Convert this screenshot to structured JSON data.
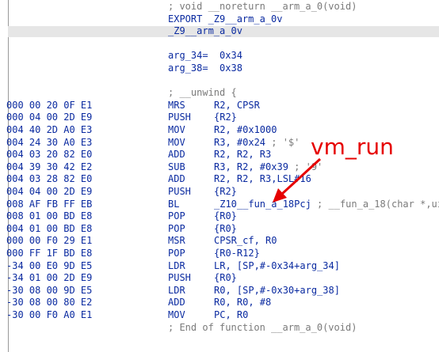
{
  "header_lines": [
    {
      "text": "; void __noreturn __arm_a_0(void)",
      "kind": "comment"
    },
    {
      "text": "EXPORT _Z9__arm_a_0v",
      "kind": "code"
    },
    {
      "text": "_Z9__arm_a_0v",
      "kind": "label"
    },
    {
      "text": "",
      "kind": "blank"
    },
    {
      "text": "arg_34=  0x34",
      "kind": "code"
    },
    {
      "text": "arg_38=  0x38",
      "kind": "code"
    },
    {
      "text": "",
      "kind": "blank"
    },
    {
      "text": "; __unwind {",
      "kind": "comment"
    }
  ],
  "instructions": [
    {
      "bytes": "000 00 20 0F E1",
      "mnemonic": "MRS",
      "operands": "R2, CPSR",
      "comment": ""
    },
    {
      "bytes": "000 04 00 2D E9",
      "mnemonic": "PUSH",
      "operands": "{R2}",
      "comment": ""
    },
    {
      "bytes": "004 40 2D A0 E3",
      "mnemonic": "MOV",
      "operands": "R2, #0x1000",
      "comment": ""
    },
    {
      "bytes": "004 24 30 A0 E3",
      "mnemonic": "MOV",
      "operands": "R3, #0x24",
      "comment": " ; '$'"
    },
    {
      "bytes": "004 03 20 82 E0",
      "mnemonic": "ADD",
      "operands": "R2, R2, R3",
      "comment": ""
    },
    {
      "bytes": "004 39 30 42 E2",
      "mnemonic": "SUB",
      "operands": "R3, R2, #0x39",
      "comment": " ; '9'"
    },
    {
      "bytes": "004 03 28 82 E0",
      "mnemonic": "ADD",
      "operands": "R2, R2, R3,LSL#16",
      "comment": ""
    },
    {
      "bytes": "004 04 00 2D E9",
      "mnemonic": "PUSH",
      "operands": "{R2}",
      "comment": ""
    },
    {
      "bytes": "008 AF FB FF EB",
      "mnemonic": "BL",
      "operands": "_Z10__fun_a_18Pcj",
      "comment": " ; __fun_a_18(char *,ui"
    },
    {
      "bytes": "008 01 00 BD E8",
      "mnemonic": "POP",
      "operands": "{R0}",
      "comment": ""
    },
    {
      "bytes": "004 01 00 BD E8",
      "mnemonic": "POP",
      "operands": "{R0}",
      "comment": ""
    },
    {
      "bytes": "000 00 F0 29 E1",
      "mnemonic": "MSR",
      "operands": "CPSR_cf, R0",
      "comment": ""
    },
    {
      "bytes": "000 FF 1F BD E8",
      "mnemonic": "POP",
      "operands": "{R0-R12}",
      "comment": ""
    },
    {
      "bytes": "-34 00 E0 9D E5",
      "mnemonic": "LDR",
      "operands": "LR, [SP,#-0x34+arg_34]",
      "comment": ""
    },
    {
      "bytes": "-34 01 00 2D E9",
      "mnemonic": "PUSH",
      "operands": "{R0}",
      "comment": ""
    },
    {
      "bytes": "-30 08 00 9D E5",
      "mnemonic": "LDR",
      "operands": "R0, [SP,#-0x30+arg_38]",
      "comment": ""
    },
    {
      "bytes": "-30 08 00 80 E2",
      "mnemonic": "ADD",
      "operands": "R0, R0, #8",
      "comment": ""
    },
    {
      "bytes": "-30 00 F0 A0 E1",
      "mnemonic": "MOV",
      "operands": "PC, R0",
      "comment": ""
    }
  ],
  "footer_line": "; End of function __arm_a_0(void)",
  "annotation": {
    "text": "vm_run",
    "color": "#e60000"
  },
  "colors": {
    "code": "#0a2aa0",
    "comment": "#7a7a7a",
    "highlight": "#e6e6e6"
  }
}
